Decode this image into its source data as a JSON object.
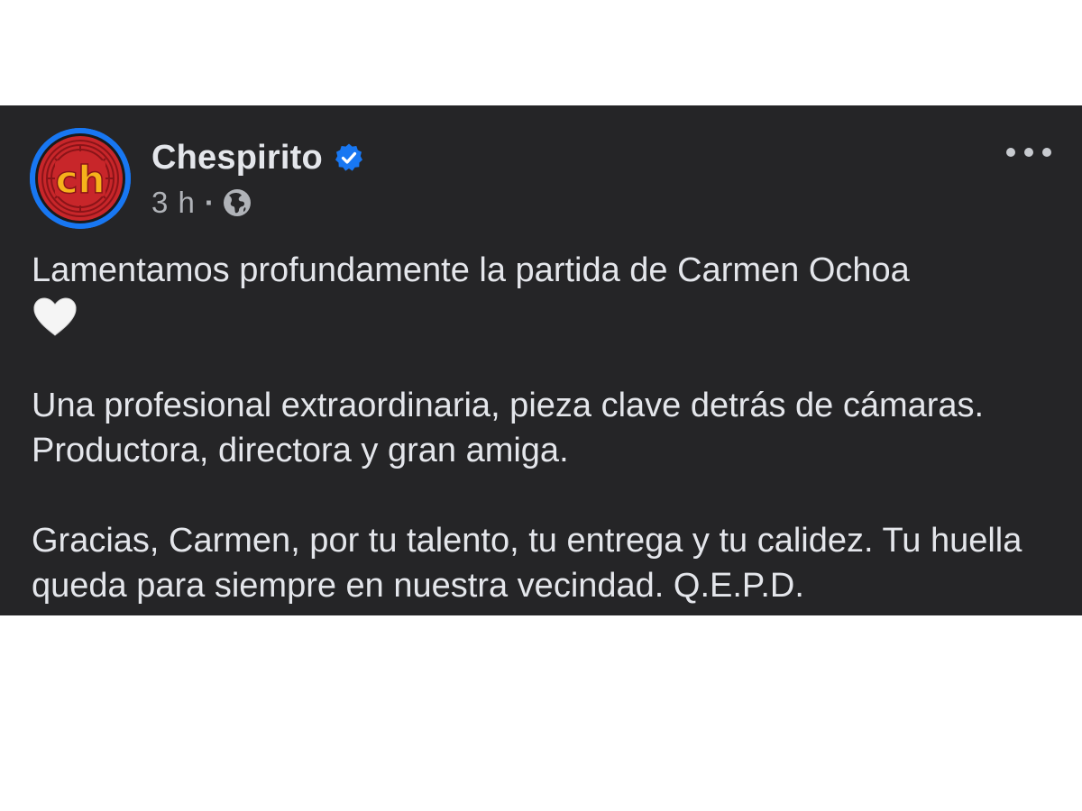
{
  "post": {
    "author": "Chespirito",
    "verified": true,
    "timestamp": "3 h",
    "separator": "·",
    "audience_icon": "globe-icon",
    "more_icon": "ellipsis-icon",
    "avatar_logo_text": "ch",
    "paragraphs": [
      {
        "text": "Lamentamos profundamente la partida de Carmen Ochoa",
        "emoji": "white-heart"
      },
      {
        "text": "Una profesional extraordinaria, pieza clave detrás de cámaras. Productora, directora y gran amiga."
      },
      {
        "text": "Gracias, Carmen, por tu talento, tu entrega y tu calidez. Tu huella queda para siempre en nuestra vecindad. Q.E.P.D."
      }
    ]
  },
  "colors": {
    "background": "#252527",
    "text": "#e4e6eb",
    "meta": "#b0b3b8",
    "verified": "#1877f2",
    "avatar_ring": "#1877f2",
    "logo_red": "#c8262a",
    "logo_yellow": "#f6b21b"
  }
}
